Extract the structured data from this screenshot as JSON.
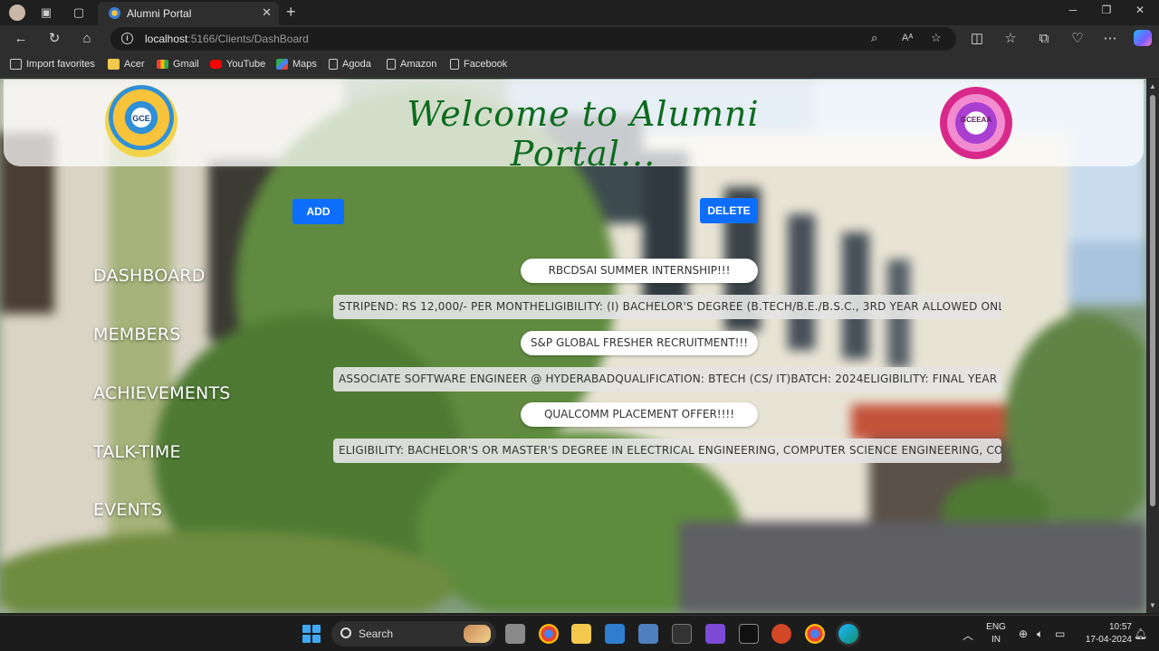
{
  "browser": {
    "tab_title": "Alumni Portal",
    "url_host": "localhost",
    "url_path": ":5166/Clients/DashBoard",
    "favorites": [
      "Import favorites",
      "Acer",
      "Gmail",
      "YouTube",
      "Maps",
      "Agoda",
      "Amazon",
      "Facebook"
    ]
  },
  "header": {
    "welcome": "Welcome to Alumni Portal...",
    "left_logo_text": "GCE",
    "right_logo_text": "GCEEAA"
  },
  "sidebar": {
    "items": [
      "Dashboard",
      "Members",
      "Achievements",
      "Talk-Time",
      "Events"
    ]
  },
  "actions": {
    "add_label": "ADD",
    "delete_label": "DELETE"
  },
  "notices": [
    {
      "title": "RBCDSAI SUMMER INTERNSHIP!!!",
      "body": "STRIPEND: RS 12,000/- PER MONTHELIGIBILITY: (I) BACHELOR'S DEGREE (B.TECH/B.E./B.S.C., 3RD YEAR ALLOWED ONLY)(I"
    },
    {
      "title": "S&P GLOBAL FRESHER RECRUITMENT!!!",
      "body": "ASSOCIATE SOFTWARE ENGINEER @ HYDERABADQUALIFICATION: BTECH (CS/ IT)BATCH: 2024ELIGIBILITY: FINAL YEAR S"
    },
    {
      "title": "QUALCOMM PLACEMENT OFFER!!!!",
      "body": "ELIGIBILITY: BACHELOR'S OR MASTER'S DEGREE IN ELECTRICAL ENGINEERING, COMPUTER SCIENCE ENGINEERING, CO"
    }
  ],
  "taskbar": {
    "search_label": "Search",
    "lang_top": "ENG",
    "lang_bottom": "IN",
    "time": "10:57",
    "date": "17-04-2024"
  }
}
